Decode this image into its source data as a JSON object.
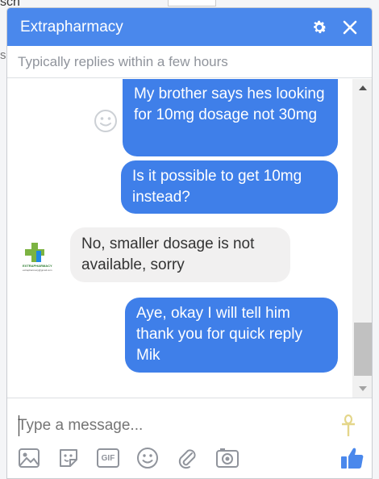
{
  "background": {
    "partial_text": "sch",
    "side_letter": "s"
  },
  "header": {
    "title": "Extrapharmacy",
    "accent": "#4a88ec"
  },
  "subheader": {
    "text": "Typically replies within a few hours"
  },
  "messages": [
    {
      "from": "me",
      "text": "My brother says hes looking for 10mg dosage not 30mg"
    },
    {
      "from": "me",
      "text": "Is it possible to get 10mg instead?"
    },
    {
      "from": "page",
      "text": "No, smaller dosage is not available, sorry"
    },
    {
      "from": "me",
      "text": "Aye, okay I will tell him thank you for quick reply Mik"
    }
  ],
  "avatar": {
    "brand_text": "EXTRAPHARMACY",
    "email_text": "extrapharmacy@gmail.com"
  },
  "composer": {
    "placeholder": "Type a message...",
    "gif_label": "GIF"
  },
  "colors": {
    "outgoing": "#3f7fe9",
    "incoming": "#f1f0f0",
    "logo_green": "#7cb342",
    "logo_blue": "#1e88e5"
  }
}
